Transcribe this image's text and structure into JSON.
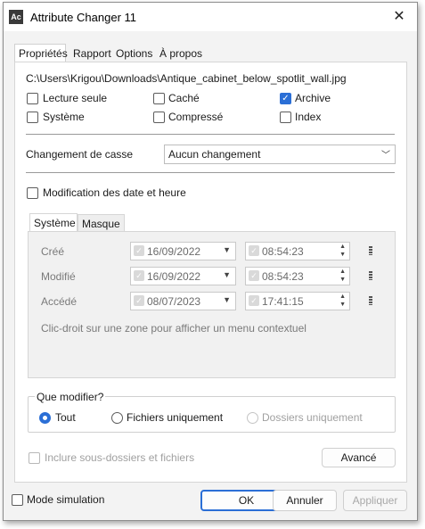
{
  "window": {
    "title": "Attribute Changer 11",
    "icon": "Ac"
  },
  "tabs": [
    "Propriétés",
    "Rapport",
    "Options",
    "À propos"
  ],
  "file_path": "C:\\Users\\Krigou\\Downloads\\Antique_cabinet_below_spotlit_wall.jpg",
  "attributes": {
    "read_only": {
      "label": "Lecture seule",
      "checked": false
    },
    "hidden": {
      "label": "Caché",
      "checked": false
    },
    "archive": {
      "label": "Archive",
      "checked": true
    },
    "system": {
      "label": "Système",
      "checked": false
    },
    "compressed": {
      "label": "Compressé",
      "checked": false
    },
    "index": {
      "label": "Index",
      "checked": false
    }
  },
  "case_change": {
    "label": "Changement de casse",
    "value": "Aucun changement"
  },
  "date_mod": {
    "label": "Modification des date et heure",
    "checked": false
  },
  "subtabs": [
    "Système",
    "Masque"
  ],
  "dates": [
    {
      "label": "Créé",
      "date": "16/09/2022",
      "time": "08:54:23"
    },
    {
      "label": "Modifié",
      "date": "16/09/2022",
      "time": "08:54:23"
    },
    {
      "label": "Accédé",
      "date": "08/07/2023",
      "time": "17:41:15"
    }
  ],
  "hint": "Clic-droit sur une zone pour afficher un menu contextuel",
  "modify": {
    "title": "Que modifier?",
    "options": [
      "Tout",
      "Fichiers uniquement",
      "Dossiers uniquement"
    ],
    "selected": "Tout"
  },
  "include_sub": "Inclure sous-dossiers et fichiers",
  "advanced": "Avancé",
  "simulation": "Mode simulation",
  "buttons": {
    "ok": "OK",
    "cancel": "Annuler",
    "apply": "Appliquer"
  },
  "colors": {
    "accent": "#2b6fd6"
  }
}
